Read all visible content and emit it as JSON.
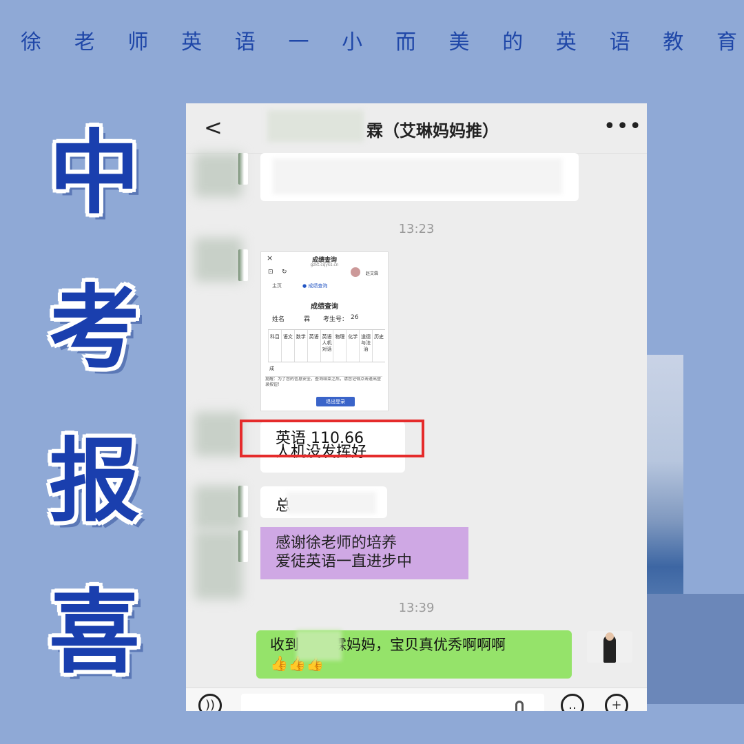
{
  "slogan": [
    "徐",
    "老",
    "师",
    "英",
    "语",
    "一",
    "小",
    "而",
    "美",
    "的",
    "英",
    "语",
    "教",
    "育"
  ],
  "big_title": [
    "中",
    "考",
    "报",
    "喜"
  ],
  "chat": {
    "title": "霖（艾琳妈妈推）",
    "back_icon": "chevron-left-icon",
    "more_icon": "more-icon",
    "timestamps": [
      "13:23",
      "13:39"
    ],
    "screenshot": {
      "title": "成绩查询",
      "url": "gzkt.cqyks.cn",
      "tab_home": "主页",
      "tab_query": "● 成绩查询",
      "user": "赵艾霖",
      "heading": "成绩查询",
      "name_label": "姓名",
      "name_value": "霖",
      "exam_no_label": "考生号：",
      "exam_no_value": "26",
      "columns": [
        "科目",
        "语文",
        "数学",
        "英语",
        "英语人机对话",
        "物理",
        "化学",
        "道德与法治",
        "历史"
      ],
      "row_label": "成",
      "notice": "提醒：为了您的信息安全，查询结束之后，请您记得点击退出登录按钮！",
      "logout": "退出登录"
    },
    "msg_score_line1": "英语 110.66",
    "msg_score_line2": "人机没发挥好",
    "msg_total": "总",
    "msg_thanks_line1": "感谢徐老师的培养",
    "msg_thanks_line2": "爱徒英语一直进步中",
    "msg_reply": "收到",
    "msg_reply_rest": "霖妈妈，宝贝真优秀啊啊啊",
    "msg_reply_emoji": "👍👍👍"
  },
  "input_bar": {
    "voice_icon": "voice-icon",
    "emoji_icon": "emoji-icon",
    "plus_icon": "plus-icon",
    "mic_icon": "mic-icon"
  }
}
